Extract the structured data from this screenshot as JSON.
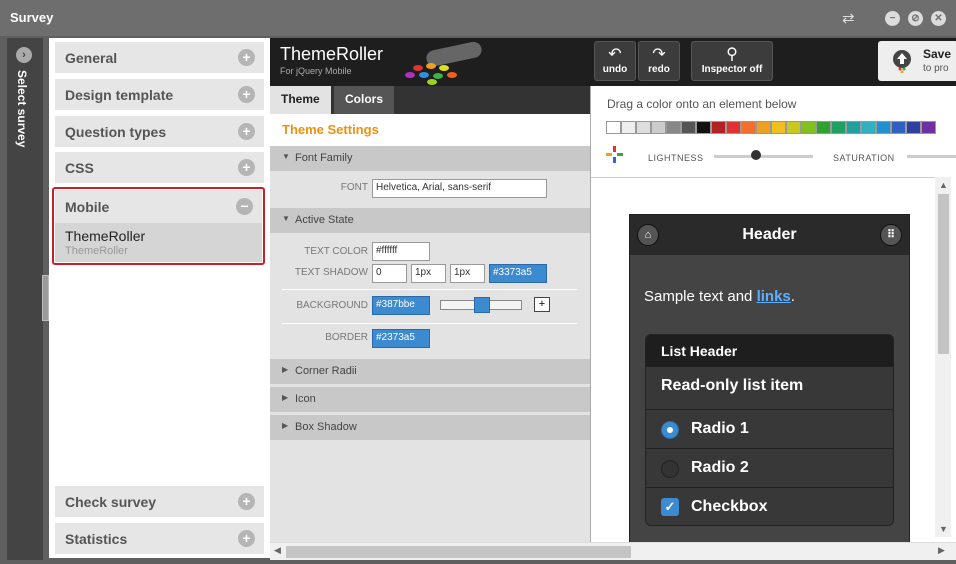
{
  "window": {
    "title": "Survey",
    "sync_icon": "swap-arrows-icon",
    "controls": [
      "minimize-icon",
      "stop-icon",
      "close-icon"
    ]
  },
  "rail": {
    "label": "Select survey",
    "icon": "chevron-right-icon"
  },
  "sidebar": {
    "items": [
      {
        "label": "General",
        "expanded": false
      },
      {
        "label": "Design template",
        "expanded": false
      },
      {
        "label": "Question types",
        "expanded": false
      },
      {
        "label": "CSS",
        "expanded": false
      },
      {
        "label": "Mobile",
        "expanded": true,
        "children": [
          {
            "title": "ThemeRoller",
            "subtitle": "ThemeRoller"
          }
        ]
      },
      {
        "label": "Check survey",
        "expanded": false
      },
      {
        "label": "Statistics",
        "expanded": false
      }
    ]
  },
  "themeroller": {
    "logo_title": "ThemeRoller",
    "logo_subtitle": "For jQuery Mobile",
    "toolbar": {
      "undo": "undo",
      "redo": "redo",
      "inspector": "Inspector",
      "inspector_state": "off",
      "save": "Save",
      "save_sub": "to pro"
    },
    "tabs": [
      "Theme",
      "Colors"
    ],
    "active_tab": "Theme",
    "settings_title": "Theme Settings",
    "sections": {
      "font_family": "Font Family",
      "active_state": "Active State",
      "corner_radii": "Corner Radii",
      "icon": "Icon",
      "box_shadow": "Box Shadow"
    },
    "fields": {
      "font_label": "FONT",
      "font_value": "Helvetica, Arial, sans-serif",
      "text_color_label": "TEXT COLOR",
      "text_color_value": "#ffffff",
      "text_shadow_label": "TEXT SHADOW",
      "text_shadow_values": [
        "0",
        "1px",
        "1px",
        "#3373a5"
      ],
      "background_label": "BACKGROUND",
      "background_value": "#387bbe",
      "background_slider_percent": 50,
      "plus_label": "+",
      "border_label": "BORDER",
      "border_value": "#2373a5"
    },
    "colors_panel": {
      "instruction": "Drag a color onto an element below",
      "swatches": [
        "#ffffff",
        "#eeeeee",
        "#dddddd",
        "#cccccc",
        "#888888",
        "#555555",
        "#111111",
        "#b22222",
        "#dd3333",
        "#f07030",
        "#f0a020",
        "#f0c020",
        "#c8c820",
        "#80c020",
        "#30a030",
        "#20a060",
        "#20a0a0",
        "#30b0c0",
        "#2090d0",
        "#3060c0",
        "#3040a0",
        "#7030a0"
      ],
      "lightness_label": "LIGHTNESS",
      "saturation_label": "SATURATION"
    },
    "preview": {
      "header": "Header",
      "home_icon": "home-icon",
      "grid_icon": "grid-icon",
      "sample_text": "Sample text and ",
      "sample_link": "links",
      "sample_end": ".",
      "list_header": "List Header",
      "readonly_item": "Read-only list item",
      "radio1": "Radio 1",
      "radio2": "Radio 2",
      "checkbox": "Checkbox"
    }
  }
}
